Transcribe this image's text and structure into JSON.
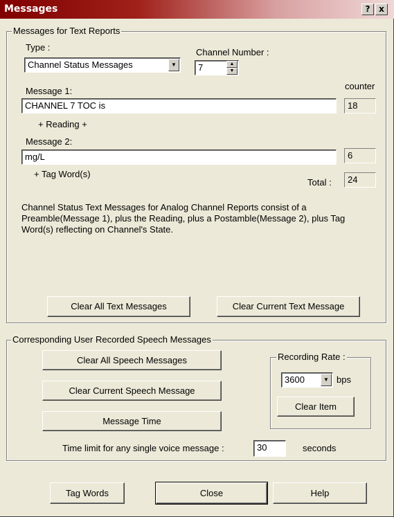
{
  "window": {
    "title": "Messages",
    "help_button": "?",
    "close_button": "x"
  },
  "text_reports": {
    "legend": "Messages for Text Reports",
    "type_label": "Type :",
    "type_value": "Channel Status Messages",
    "channel_label": "Channel Number :",
    "channel_value": "7",
    "counter_label": "counter",
    "message1_label": "Message 1:",
    "message1_value": "CHANNEL 7 TOC is",
    "message1_count": "18",
    "reading_label": "+ Reading +",
    "message2_label": "Message 2:",
    "message2_value": "mg/L",
    "message2_count": "6",
    "tagword_label": "+ Tag Word(s)",
    "total_label": "Total :",
    "total_value": "24",
    "description": "Channel Status Text Messages for Analog Channel Reports consist of a Preamble(Message 1), plus the Reading, plus a Postamble(Message 2), plus Tag Word(s) reflecting on Channel's State.",
    "clear_all_label": "Clear All Text Messages",
    "clear_current_label": "Clear Current Text Message"
  },
  "speech": {
    "legend": "Corresponding User Recorded Speech Messages",
    "clear_all_label": "Clear All Speech Messages",
    "clear_current_label": "Clear Current Speech Message",
    "message_time_label": "Message Time",
    "rate_legend": "Recording Rate :",
    "rate_value": "3600",
    "rate_unit": "bps",
    "clear_item_label": "Clear Item",
    "time_limit_label": "Time limit for any single voice message :",
    "time_limit_value": "30",
    "seconds_label": "seconds"
  },
  "footer": {
    "tag_words_label": "Tag Words",
    "close_label": "Close",
    "help_label": "Help"
  }
}
